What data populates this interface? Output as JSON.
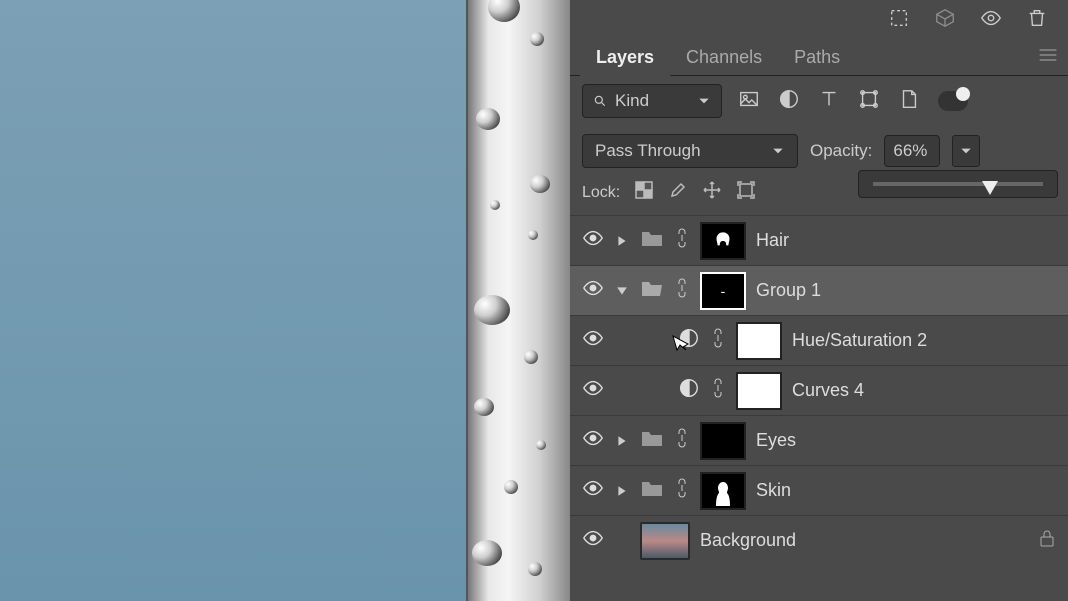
{
  "tabs": {
    "layers": "Layers",
    "channels": "Channels",
    "paths": "Paths"
  },
  "filter": {
    "kind": "Kind"
  },
  "blend": {
    "mode": "Pass Through",
    "opacity_label": "Opacity:",
    "opacity_value": "66%"
  },
  "lock": {
    "label": "Lock:"
  },
  "layers": [
    {
      "name": "Hair"
    },
    {
      "name": "Group 1"
    },
    {
      "name": "Hue/Saturation 2"
    },
    {
      "name": "Curves 4"
    },
    {
      "name": "Eyes"
    },
    {
      "name": "Skin"
    },
    {
      "name": "Background"
    }
  ]
}
